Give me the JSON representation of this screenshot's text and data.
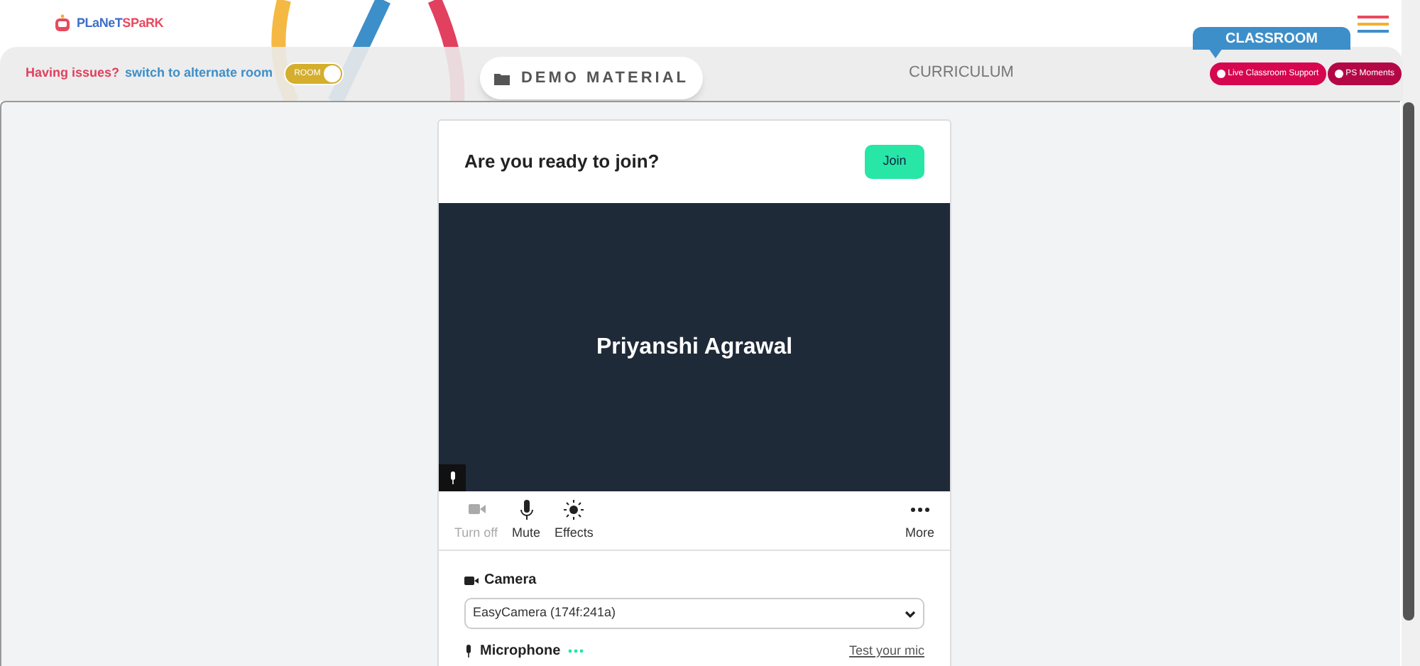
{
  "header": {
    "logo_prefix": "PLaNeT",
    "logo_suffix": "SPaRK"
  },
  "bar": {
    "issue_text": "Having issues?",
    "switch_link": "switch to alternate room",
    "toggle": {
      "label": "ROOM",
      "on": true
    },
    "demo_button": "DEMO MATERIAL",
    "curriculum": "CURRICULUM",
    "classroom_tab": "CLASSROOM",
    "pills": [
      {
        "label": "Live Classroom Support",
        "color": "#d6064f"
      },
      {
        "label": "PS Moments",
        "color": "#b30845"
      }
    ]
  },
  "card": {
    "title": "Are you ready to join?",
    "join_button": "Join",
    "participant_name": "Priyanshi Agrawal",
    "controls": [
      {
        "kind": "camera",
        "label": "Turn off",
        "disabled": true
      },
      {
        "kind": "mic",
        "label": "Mute",
        "disabled": false
      },
      {
        "kind": "effects",
        "label": "Effects",
        "disabled": false
      },
      {
        "kind": "more",
        "label": "More",
        "disabled": false
      }
    ],
    "camera": {
      "label": "Camera",
      "value": "EasyCamera (174f:241a)"
    },
    "microphone": {
      "label": "Microphone",
      "test_link": "Test your mic"
    }
  }
}
